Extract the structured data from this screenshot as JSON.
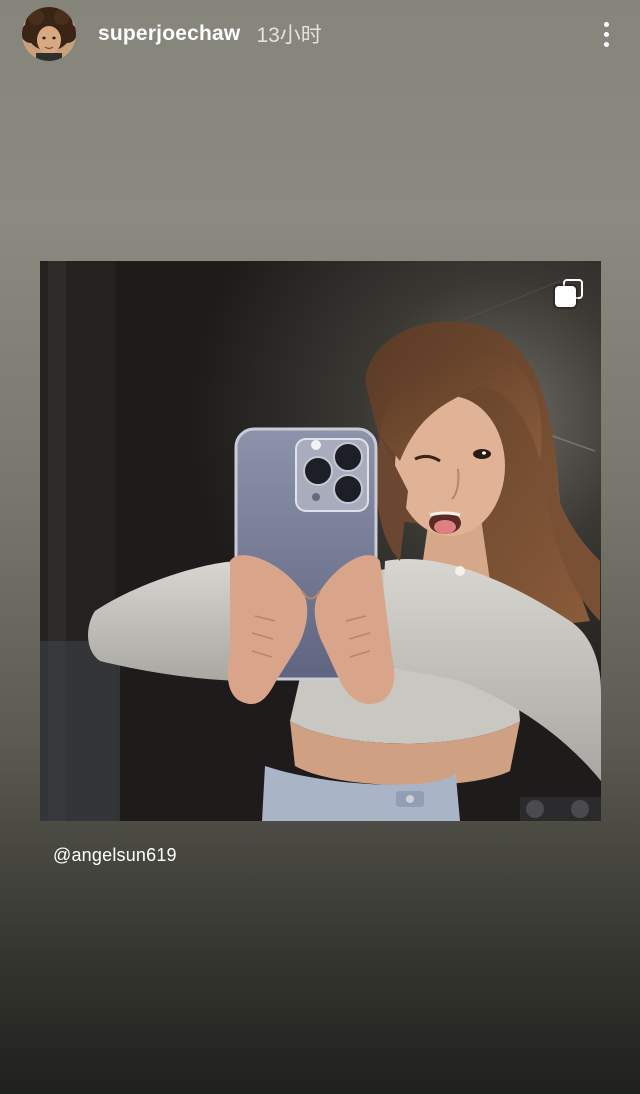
{
  "story": {
    "username": "superjoechaw",
    "timestamp": "13小时",
    "mention": "@angelsun619"
  },
  "icons": {
    "more": "more-vertical-icon",
    "multi_post": "multi-post-icon"
  },
  "colors": {
    "text": "#ffffff",
    "timestamp": "#e3e3dc"
  }
}
